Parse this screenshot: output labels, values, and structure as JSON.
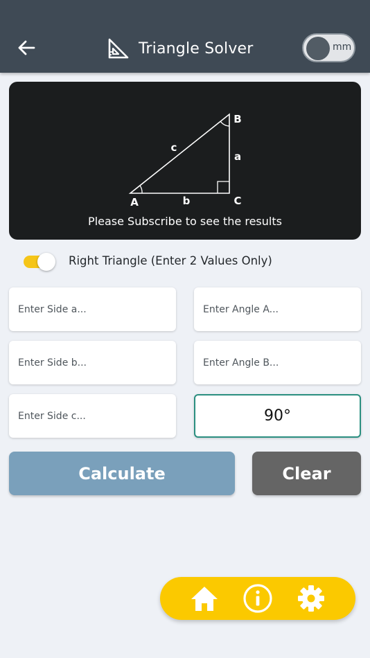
{
  "appbar": {
    "title": "Triangle Solver",
    "unit_label": "mm",
    "back_icon": "arrow-left-icon",
    "title_icon": "set-square-icon"
  },
  "diagram": {
    "vertex_a": "A",
    "vertex_b": "B",
    "vertex_c": "C",
    "side_a": "a",
    "side_b": "b",
    "side_c": "c",
    "message": "Please Subscribe to see the results"
  },
  "right_triangle": {
    "label": "Right Triangle (Enter 2 Values Only)",
    "enabled": true
  },
  "inputs": {
    "side_a": {
      "placeholder": "Enter Side a...",
      "value": ""
    },
    "side_b": {
      "placeholder": "Enter Side b...",
      "value": ""
    },
    "side_c": {
      "placeholder": "Enter Side c...",
      "value": ""
    },
    "angle_a": {
      "placeholder": "Enter Angle A...",
      "value": ""
    },
    "angle_b": {
      "placeholder": "Enter Angle B...",
      "value": ""
    },
    "angle_c": {
      "placeholder": "",
      "value": "90°"
    }
  },
  "buttons": {
    "calculate": "Calculate",
    "clear": "Clear"
  },
  "bottom_nav": {
    "items": [
      "home-icon",
      "info-icon",
      "settings-icon"
    ]
  },
  "colors": {
    "appbar": "#3f4a55",
    "accent_yellow": "#fbc900",
    "calculate": "#7aa0bb",
    "clear": "#656565",
    "active_border": "#2a8f80"
  }
}
